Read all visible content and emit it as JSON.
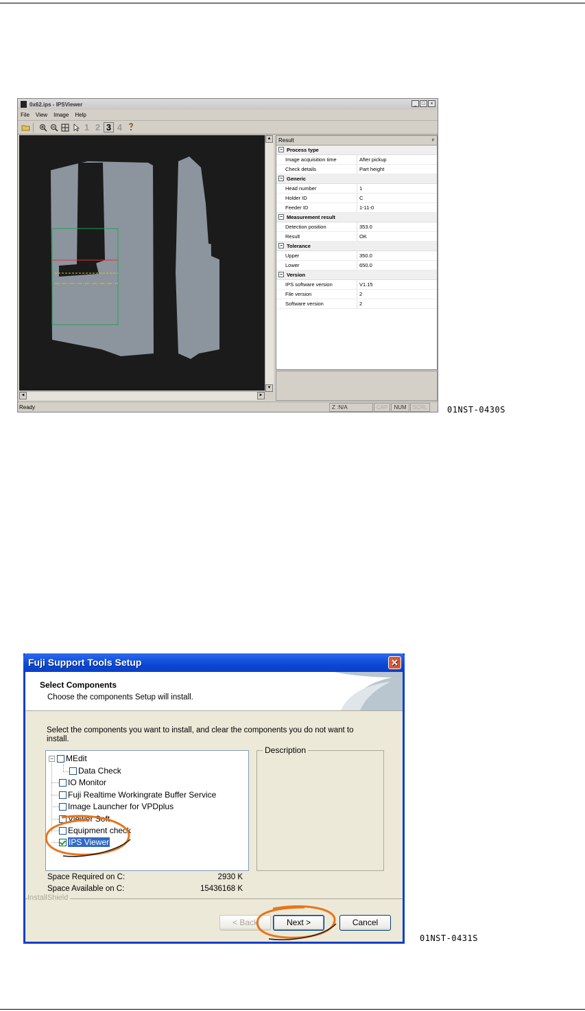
{
  "figure1": {
    "ref_code": "01NST-0430S",
    "window_title": "0x62.ips - IPSViewer",
    "window_buttons": [
      "_",
      "□",
      "×"
    ],
    "menu": [
      "File",
      "View",
      "Image",
      "Help"
    ],
    "toolbar_numbers": [
      "1",
      "2",
      "3",
      "4"
    ],
    "result_header": "Result",
    "result_groups": [
      {
        "name": "Process type",
        "items": [
          [
            "Image acquisition time",
            "After pickup"
          ],
          [
            "Check details",
            "Part height"
          ]
        ]
      },
      {
        "name": "Generic",
        "items": [
          [
            "Head number",
            "1"
          ],
          [
            "Holder ID",
            "C"
          ],
          [
            "Feeder ID",
            "1-11-0"
          ]
        ]
      },
      {
        "name": "Measurement result",
        "items": [
          [
            "Detection position",
            "353.0"
          ],
          [
            "Result",
            "OK"
          ]
        ]
      },
      {
        "name": "Tolerance",
        "items": [
          [
            "Upper",
            "350.0"
          ],
          [
            "Lower",
            "650.0"
          ]
        ]
      },
      {
        "name": "Version",
        "items": [
          [
            "IPS software version",
            "V1.15"
          ],
          [
            "File version",
            "2"
          ],
          [
            "Software version",
            "2"
          ]
        ]
      }
    ],
    "status": {
      "ready": "Ready",
      "z": "Z :N/A",
      "cap": "CAP",
      "num": "NUM",
      "scrl": "SCRL"
    }
  },
  "figure2": {
    "ref_code": "01NST-0431S",
    "title": "Fuji Support Tools Setup",
    "heading": "Select Components",
    "subheading": "Choose the components Setup will install.",
    "prompt": "Select the components you want to install, and clear the components you do not want to install.",
    "components": [
      {
        "label": "MEdit",
        "checked": false
      },
      {
        "label": "Data Check",
        "checked": false
      },
      {
        "label": "IO Monitor",
        "checked": false
      },
      {
        "label": "Fuji Realtime Workingrate Buffer Service",
        "checked": false
      },
      {
        "label": "Image Launcher for VPDplus",
        "checked": false
      },
      {
        "label": "Viewer Soft",
        "checked": false
      },
      {
        "label": "Equipment check",
        "checked": false
      },
      {
        "label": "IPS Viewer",
        "checked": true
      }
    ],
    "description_label": "Description",
    "space_required_label": "Space Required on  C:",
    "space_required_value": "2930 K",
    "space_available_label": "Space Available on  C:",
    "space_available_value": "15436168 K",
    "installshield": "InstallShield",
    "back_button": "< Back",
    "next_button": "Next >",
    "cancel_button": "Cancel"
  }
}
